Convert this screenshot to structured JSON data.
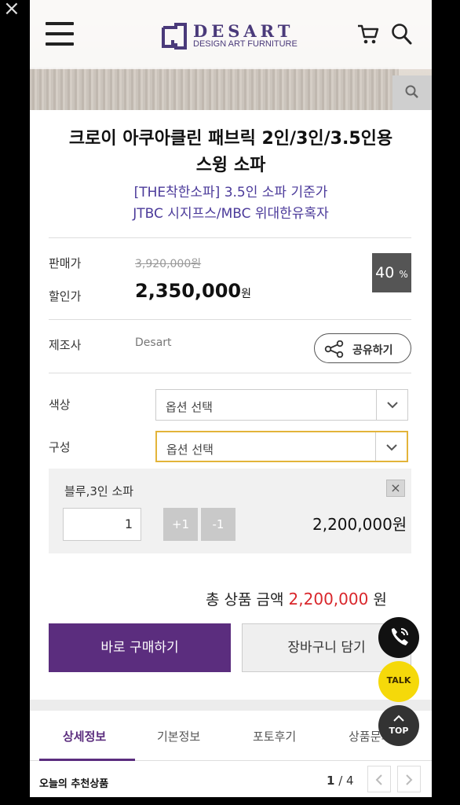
{
  "header": {
    "brand_name": "DESART",
    "brand_sub": "DESIGN ART FURNITURE",
    "close_glyph": "×"
  },
  "product": {
    "title_line1": "크로이 아쿠아클린 패브릭 2인/3인/3.5인용",
    "title_line2": "스윙 소파",
    "subtitle_line1": "[THE착한소파] 3.5인 소파 기준가",
    "subtitle_line2": "JTBC 시지프스/MBC 위대한유혹자"
  },
  "price": {
    "list_label": "판매가",
    "list_value": "3,920,000원",
    "sale_label": "할인가",
    "sale_value": "2,350,000",
    "sale_unit": "원",
    "discount_value": "40",
    "discount_unit": "%"
  },
  "maker": {
    "label": "제조사",
    "value": "Desart",
    "share_label": "공유하기"
  },
  "options": {
    "color_label": "색상",
    "color_value": "옵션 선택",
    "config_label": "구성",
    "config_value": "옵션 선택"
  },
  "selected_item": {
    "name": "블루,3인 소파",
    "remove": "×",
    "quantity": "1",
    "plus": "+1",
    "minus": "-1",
    "price": "2,200,000원"
  },
  "total": {
    "label": "총 상품 금액",
    "amount": "2,200,000",
    "unit": "원"
  },
  "actions": {
    "buy": "바로 구매하기",
    "cart": "장바구니 담기"
  },
  "tabs": [
    "상세정보",
    "기본정보",
    "포토후기",
    "상품문의"
  ],
  "recommend": {
    "title": "오늘의 추천상품",
    "page_current": "1",
    "page_sep": " / ",
    "page_total": "4"
  },
  "floating": {
    "talk": "TALK",
    "top": "TOP"
  },
  "colors": {
    "brand": "#5b2d7e",
    "accent_red": "#d9262b",
    "subtitle_blue": "#4b3a9a",
    "highlight_border": "#e3b43a"
  }
}
